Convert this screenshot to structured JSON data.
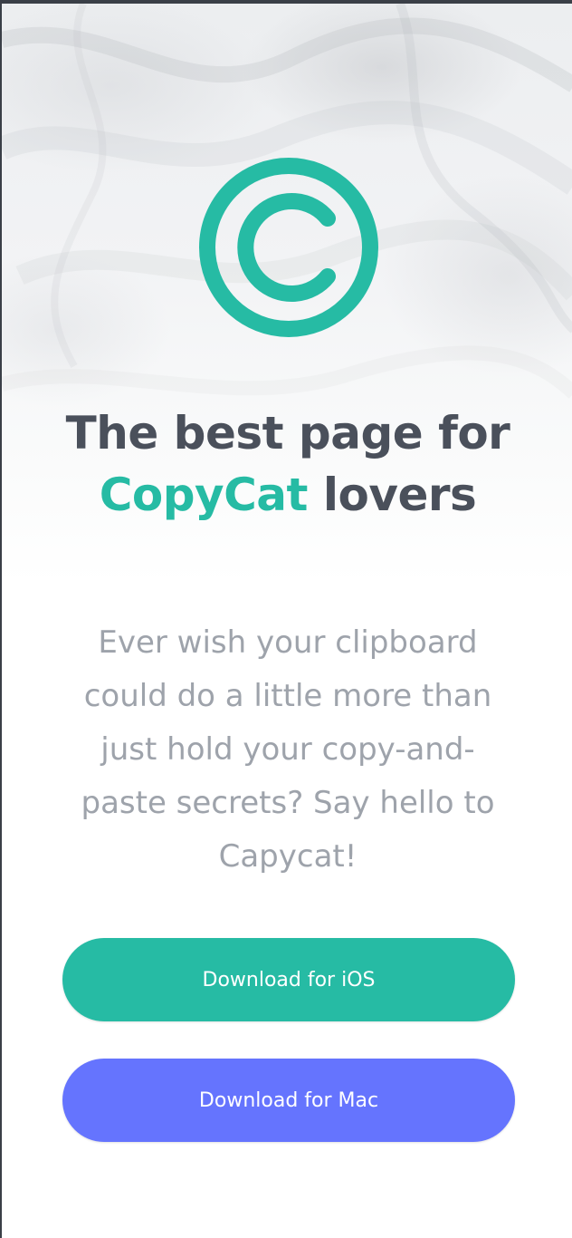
{
  "hero": {
    "headline_line1": "The best page for",
    "headline_accent": "CopyCat",
    "headline_rest": "lovers",
    "description": "Ever wish your clipboard could do a little more than just hold your copy-and-paste secrets? Say hello to Capycat!"
  },
  "buttons": {
    "ios_label": "Download for iOS",
    "mac_label": "Download for Mac"
  },
  "logo": {
    "icon": "copyright-icon",
    "color": "#26bba4"
  },
  "colors": {
    "accent": "#26bba4",
    "mac_button": "#6574fe",
    "headline": "#4a505b",
    "body_text": "#9ea3ab"
  }
}
